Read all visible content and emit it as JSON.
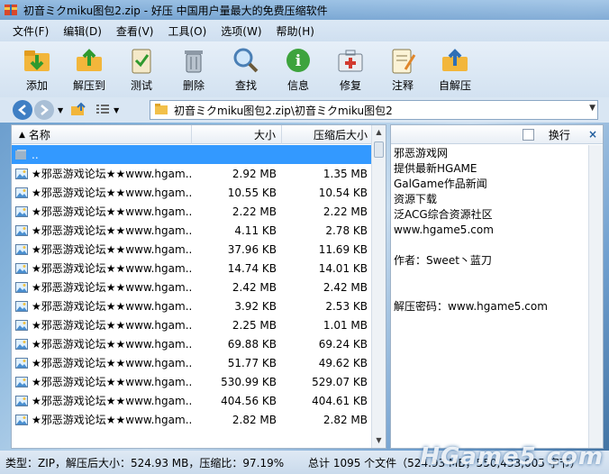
{
  "window": {
    "title": "初音ミクmiku图包2.zip - 好压 中国用户量最大的免费压缩软件"
  },
  "menu": [
    "文件(F)",
    "编辑(D)",
    "查看(V)",
    "工具(O)",
    "选项(W)",
    "帮助(H)"
  ],
  "toolbar": [
    {
      "label": "添加",
      "icon": "add-icon"
    },
    {
      "label": "解压到",
      "icon": "extract-icon"
    },
    {
      "label": "测试",
      "icon": "test-icon"
    },
    {
      "label": "删除",
      "icon": "delete-icon"
    },
    {
      "label": "查找",
      "icon": "find-icon"
    },
    {
      "label": "信息",
      "icon": "info-icon"
    },
    {
      "label": "修复",
      "icon": "repair-icon"
    },
    {
      "label": "注释",
      "icon": "comment-icon"
    },
    {
      "label": "自解压",
      "icon": "sfx-icon"
    }
  ],
  "address": {
    "path": "初音ミクmiku图包2.zip\\初音ミクmiku图包2"
  },
  "columns": {
    "name": "名称",
    "size": "大小",
    "compressed": "压缩后大小"
  },
  "rows": [
    {
      "name": "..",
      "size": "",
      "csize": "",
      "selected": true
    },
    {
      "name": "★邪恶游戏论坛★★www.hgam...",
      "size": "2.92 MB",
      "csize": "1.35 MB"
    },
    {
      "name": "★邪恶游戏论坛★★www.hgam...",
      "size": "10.55 KB",
      "csize": "10.54 KB"
    },
    {
      "name": "★邪恶游戏论坛★★www.hgam...",
      "size": "2.22 MB",
      "csize": "2.22 MB"
    },
    {
      "name": "★邪恶游戏论坛★★www.hgam...",
      "size": "4.11 KB",
      "csize": "2.78 KB"
    },
    {
      "name": "★邪恶游戏论坛★★www.hgam...",
      "size": "37.96 KB",
      "csize": "11.69 KB"
    },
    {
      "name": "★邪恶游戏论坛★★www.hgam...",
      "size": "14.74 KB",
      "csize": "14.01 KB"
    },
    {
      "name": "★邪恶游戏论坛★★www.hgam...",
      "size": "2.42 MB",
      "csize": "2.42 MB"
    },
    {
      "name": "★邪恶游戏论坛★★www.hgam...",
      "size": "3.92 KB",
      "csize": "2.53 KB"
    },
    {
      "name": "★邪恶游戏论坛★★www.hgam...",
      "size": "2.25 MB",
      "csize": "1.01 MB"
    },
    {
      "name": "★邪恶游戏论坛★★www.hgam...",
      "size": "69.88 KB",
      "csize": "69.24 KB"
    },
    {
      "name": "★邪恶游戏论坛★★www.hgam...",
      "size": "51.77 KB",
      "csize": "49.62 KB"
    },
    {
      "name": "★邪恶游戏论坛★★www.hgam...",
      "size": "530.99 KB",
      "csize": "529.07 KB"
    },
    {
      "name": "★邪恶游戏论坛★★www.hgam...",
      "size": "404.56 KB",
      "csize": "404.61 KB"
    },
    {
      "name": "★邪恶游戏论坛★★www.hgam...",
      "size": "2.82 MB",
      "csize": "2.82 MB"
    }
  ],
  "comment": {
    "wrap_label": "换行",
    "close": "×",
    "lines": [
      "邪恶游戏网",
      "提供最新HGAME",
      "GalGame作品新闻",
      "资源下载",
      "泛ACG综合资源社区",
      "www.hgame5.com",
      "",
      "作者：Sweet丶蓝刀",
      "",
      "",
      "解压密码：www.hgame5.com"
    ]
  },
  "status": {
    "left": "类型：ZIP，解压后大小：524.93 MB，压缩比：97.19%",
    "right": "总计 1095 个文件（524.93 MB，550,433,005 字节）"
  },
  "watermark": "HGame5.com",
  "colors": {
    "selected": "#3399ff",
    "accent": "#2f6fb5"
  }
}
